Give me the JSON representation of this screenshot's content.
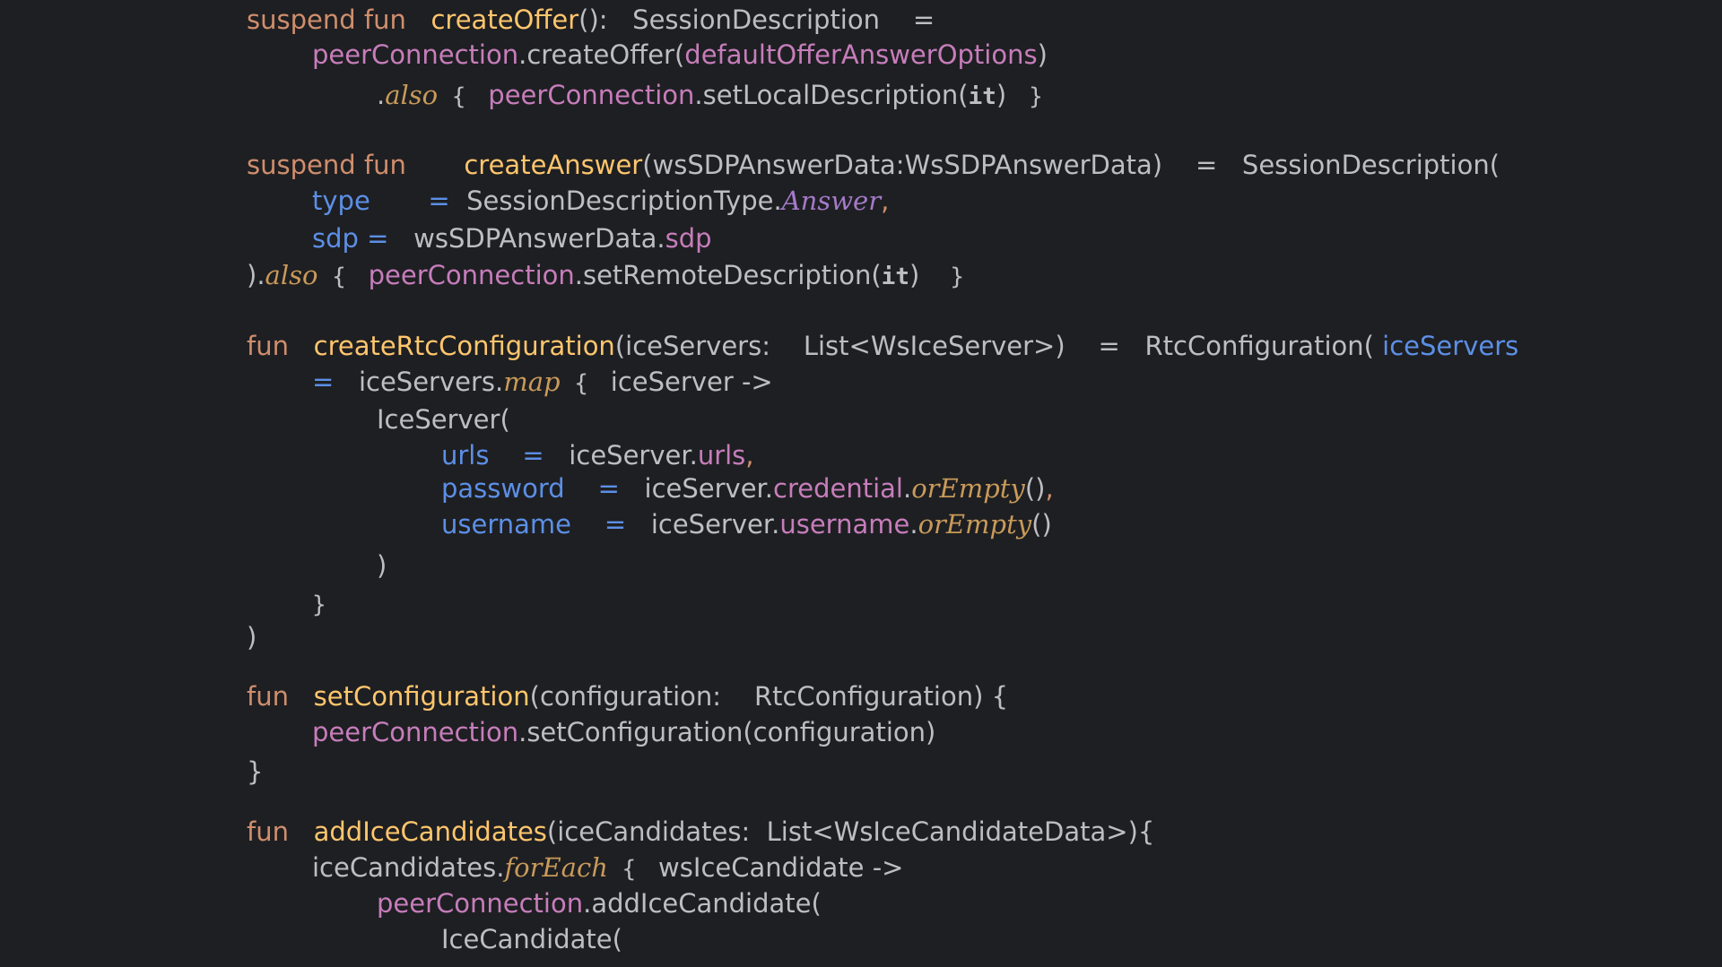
{
  "lines": [
    [
      [
        "kw",
        "suspend fun   "
      ],
      [
        "fn",
        "createOffer"
      ],
      [
        "plain",
        "():   SessionDescription    ="
      ]
    ],
    [
      [
        "prop",
        "peerConnection"
      ],
      [
        "plain",
        ".createOffer("
      ],
      [
        "prop",
        "defaultOfferAnswerOptions"
      ],
      [
        "plain",
        ")"
      ]
    ],
    [
      [
        "plain",
        "."
      ],
      [
        "ext",
        "also"
      ],
      [
        "brace",
        " { "
      ],
      [
        "prop",
        " peerConnection"
      ],
      [
        "plain",
        ".setLocalDescription("
      ],
      [
        "it",
        "it"
      ],
      [
        "plain",
        ") "
      ],
      [
        "brace",
        " }"
      ]
    ],
    [
      [
        "kw",
        "suspend fun       "
      ],
      [
        "fn",
        "createAnswer"
      ],
      [
        "plain",
        "(wsSDPAnswerData:WsSDPAnswerData)    =   SessionDescription("
      ]
    ],
    [
      [
        "param",
        "type"
      ],
      [
        "plain",
        "       "
      ],
      [
        "param",
        "="
      ],
      [
        "plain",
        "  SessionDescriptionType."
      ],
      [
        "cnst",
        "Answer"
      ],
      [
        "kw",
        ","
      ]
    ],
    [
      [
        "param",
        "sdp"
      ],
      [
        "param",
        " ="
      ],
      [
        "plain",
        "   wsSDPAnswerData."
      ],
      [
        "prop",
        "sdp"
      ]
    ],
    [
      [
        "plain",
        ")."
      ],
      [
        "ext",
        "also"
      ],
      [
        "brace",
        " { "
      ],
      [
        "prop",
        " peerConnection"
      ],
      [
        "plain",
        ".setRemoteDescription("
      ],
      [
        "it",
        "it"
      ],
      [
        "plain",
        ")  "
      ],
      [
        "brace",
        " }"
      ]
    ],
    [
      [
        "kw",
        "fun   "
      ],
      [
        "fn",
        "createRtcConfiguration"
      ],
      [
        "plain",
        "(iceServers:    List<WsIceServer>)    =   RtcConfiguration( "
      ],
      [
        "param",
        "iceServers"
      ]
    ],
    [
      [
        "param",
        "="
      ],
      [
        "plain",
        "   iceServers."
      ],
      [
        "ext",
        "map"
      ],
      [
        "brace",
        " { "
      ],
      [
        "plain",
        " iceServer ->"
      ]
    ],
    [
      [
        "plain",
        "IceServer("
      ]
    ],
    [
      [
        "param",
        "urls"
      ],
      [
        "plain",
        "    "
      ],
      [
        "param",
        "="
      ],
      [
        "plain",
        "   iceServer."
      ],
      [
        "prop",
        "urls"
      ],
      [
        "kw",
        ","
      ]
    ],
    [
      [
        "param",
        "password"
      ],
      [
        "plain",
        "    "
      ],
      [
        "param",
        "="
      ],
      [
        "plain",
        "   iceServer."
      ],
      [
        "prop",
        "credential"
      ],
      [
        "plain",
        "."
      ],
      [
        "ext",
        "orEmpty"
      ],
      [
        "plain",
        "()"
      ],
      [
        "kw",
        ","
      ]
    ],
    [
      [
        "param",
        "username"
      ],
      [
        "plain",
        "    "
      ],
      [
        "param",
        "="
      ],
      [
        "plain",
        "   iceServer."
      ],
      [
        "prop",
        "username"
      ],
      [
        "plain",
        "."
      ],
      [
        "ext",
        "orEmpty"
      ],
      [
        "plain",
        "()"
      ]
    ],
    [
      [
        "plain",
        ")"
      ]
    ],
    [
      [
        "brace",
        "}"
      ]
    ],
    [
      [
        "plain",
        ")"
      ]
    ],
    [
      [
        "kw",
        "fun   "
      ],
      [
        "fn",
        "setConfiguration"
      ],
      [
        "plain",
        "(configuration:    RtcConfiguration) {"
      ]
    ],
    [
      [
        "prop",
        "peerConnection"
      ],
      [
        "plain",
        ".setConfiguration(configuration)"
      ]
    ],
    [
      [
        "plain",
        "}"
      ]
    ],
    [
      [
        "kw",
        "fun   "
      ],
      [
        "fn",
        "addIceCandidates"
      ],
      [
        "plain",
        "(iceCandidates:  List<WsIceCandidateData>){"
      ]
    ],
    [
      [
        "plain",
        "iceCandidates."
      ],
      [
        "ext",
        "forEach"
      ],
      [
        "brace",
        " { "
      ],
      [
        "plain",
        " wsIceCandidate ->"
      ]
    ],
    [
      [
        "prop",
        "peerConnection"
      ],
      [
        "plain",
        ".addIceCandidate("
      ]
    ],
    [
      [
        "plain",
        "IceCandidate("
      ]
    ]
  ]
}
